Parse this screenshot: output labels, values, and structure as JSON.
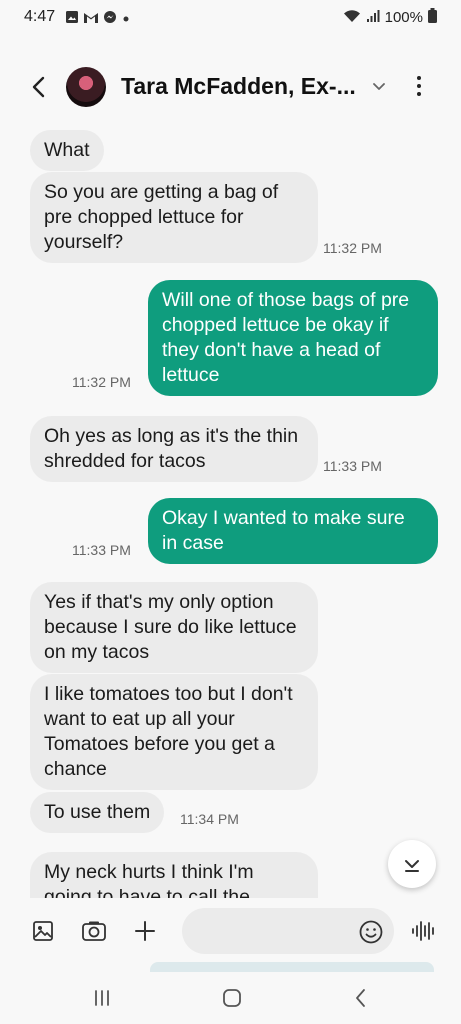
{
  "status_bar": {
    "time": "4:47",
    "battery": "100%",
    "notification_icons": [
      "image-icon",
      "gmail-icon",
      "messenger-icon",
      "dot-icon"
    ],
    "system_icons": [
      "wifi-icon",
      "signal-icon",
      "battery-icon"
    ]
  },
  "header": {
    "contact_name": "Tara McFadden, Ex-...",
    "back_icon": "back-arrow-icon",
    "expand_icon": "chevron-down-icon",
    "more_icon": "more-vert-icon"
  },
  "messages": [
    {
      "direction": "incoming",
      "text": "What",
      "time": ""
    },
    {
      "direction": "incoming",
      "text": "So you are getting a bag of pre chopped lettuce for yourself?",
      "time": "11:32 PM"
    },
    {
      "direction": "outgoing",
      "text": "Will one of those bags of pre chopped lettuce be okay if they don't have a head of lettuce",
      "time": "11:32 PM"
    },
    {
      "direction": "incoming",
      "text": "Oh yes as long as it's the thin shredded for tacos",
      "time": "11:33 PM"
    },
    {
      "direction": "outgoing",
      "text": "Okay I wanted to make sure in case",
      "time": "11:33 PM"
    },
    {
      "direction": "incoming",
      "text": "Yes if that's my only option because I sure do like lettuce on my tacos",
      "time": ""
    },
    {
      "direction": "incoming",
      "text": "I like tomatoes too but I don't want to eat up all your Tomatoes before you get a chance",
      "time": ""
    },
    {
      "direction": "incoming",
      "text": "To use them",
      "time": "11:34 PM"
    },
    {
      "direction": "incoming",
      "text": "My neck hurts I think I'm going to have to call the ambulance",
      "time": ""
    }
  ],
  "compose": {
    "placeholder": "",
    "icons": [
      "gallery-icon",
      "camera-icon",
      "plus-icon",
      "emoji-icon",
      "voice-record-icon"
    ]
  },
  "nav_bar": {
    "icons": [
      "recent-apps-icon",
      "home-icon",
      "back-icon"
    ]
  },
  "colors": {
    "outgoing_bubble": "#0f9d7e",
    "incoming_bubble": "#ebebeb",
    "background": "#f8f8f8"
  }
}
